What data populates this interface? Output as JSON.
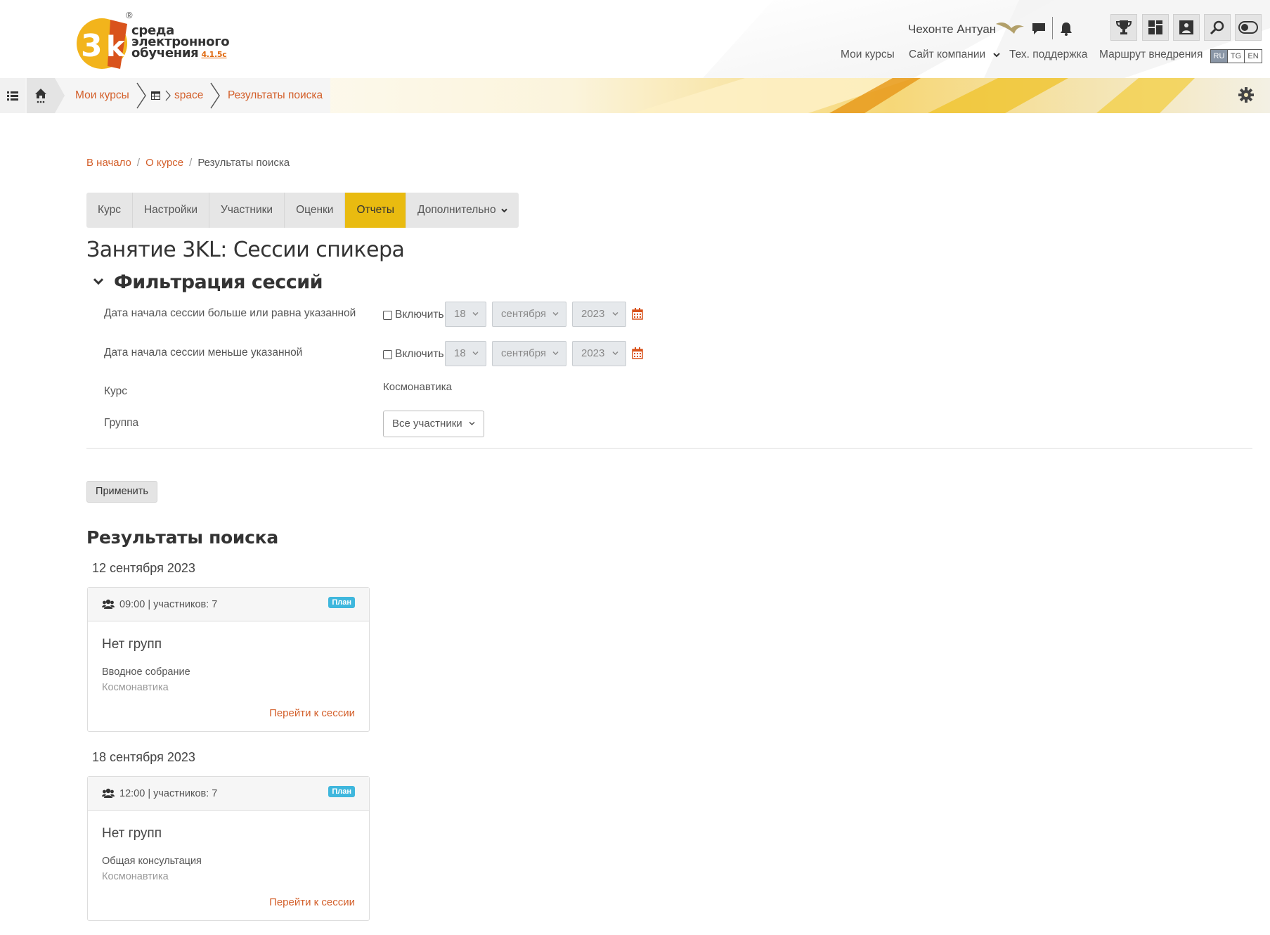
{
  "header": {
    "logo": {
      "line1": "среда",
      "line2": "электронного",
      "line3": "обучения",
      "version": "4.1.5c",
      "mark": "3k",
      "registered": "®"
    },
    "user_name": "Чехонте Антуан",
    "nav": {
      "my_courses": "Мои курсы",
      "company_site": "Сайт компании",
      "support": "Тех. поддержка",
      "route": "Маршрут внедрения"
    },
    "languages": [
      "RU",
      "TG",
      "EN"
    ],
    "active_language": "RU",
    "icons": [
      "message-icon",
      "bell-icon",
      "trophy-icon",
      "dashboard-icon",
      "portfolio-icon",
      "search-icon",
      "toggle-icon"
    ],
    "accent_color": "#e9bb10",
    "link_color": "#d35f2a"
  },
  "crumbbar": {
    "my_courses": "Мои курсы",
    "course": "space",
    "current": "Результаты поиска"
  },
  "breadcrumb": {
    "home": "В начало",
    "about": "О курсе",
    "current": "Результаты поиска"
  },
  "tabs": [
    {
      "label": "Курс",
      "active": false
    },
    {
      "label": "Настройки",
      "active": false
    },
    {
      "label": "Участники",
      "active": false
    },
    {
      "label": "Оценки",
      "active": false
    },
    {
      "label": "Отчеты",
      "active": true
    },
    {
      "label": "Дополнительно",
      "active": false
    }
  ],
  "page_title": "Занятие 3KL: Сессии спикера",
  "filter": {
    "title": "Фильтрация сессий",
    "date_from": {
      "label": "Дата начала сессии больше или равна указанной",
      "enable_label": "Включить",
      "day": "18",
      "month": "сентября",
      "year": "2023"
    },
    "date_to": {
      "label": "Дата начала сессии меньше указанной",
      "enable_label": "Включить",
      "day": "18",
      "month": "сентября",
      "year": "2023"
    },
    "course_label": "Курс",
    "course_value": "Космонавтика",
    "group_label": "Группа",
    "group_value": "Все участники",
    "apply": "Применить"
  },
  "results": {
    "title": "Результаты поиска",
    "sessions": [
      {
        "date": "12 сентября 2023",
        "time": "09:00 | участников: 7",
        "badge": "План",
        "title": "Нет групп",
        "name": "Вводное собрание",
        "course": "Космонавтика",
        "link": "Перейти к сессии"
      },
      {
        "date": "18 сентября 2023",
        "time": "12:00 | участников: 7",
        "badge": "План",
        "title": "Нет групп",
        "name": "Общая консультация",
        "course": "Космонавтика",
        "link": "Перейти к сессии"
      }
    ]
  }
}
